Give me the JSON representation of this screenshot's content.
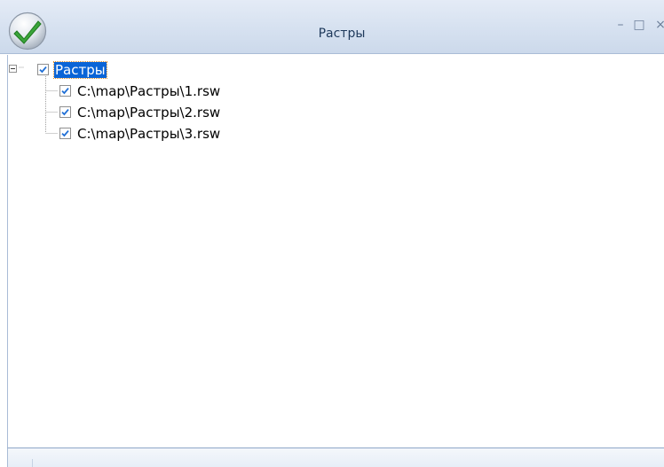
{
  "window": {
    "title": "Растры",
    "controls": {
      "minimize": "–",
      "maximize": "□",
      "close": "×"
    }
  },
  "tree": {
    "root": {
      "label": "Растры",
      "checked": true,
      "expanded": true,
      "selected": true
    },
    "children": [
      {
        "label": "C:\\map\\Растры\\1.rsw",
        "checked": true
      },
      {
        "label": "C:\\map\\Растры\\2.rsw",
        "checked": true
      },
      {
        "label": "C:\\map\\Растры\\3.rsw",
        "checked": true
      }
    ]
  },
  "colors": {
    "selection": "#0a64d7",
    "checkmark": "#1f6fd6",
    "titlebar": "#d6e1f0"
  },
  "icons": {
    "app": "green-checkmark-circle-icon",
    "expander": "collapse-minus-icon",
    "checkbox": "checked-checkbox-icon"
  }
}
